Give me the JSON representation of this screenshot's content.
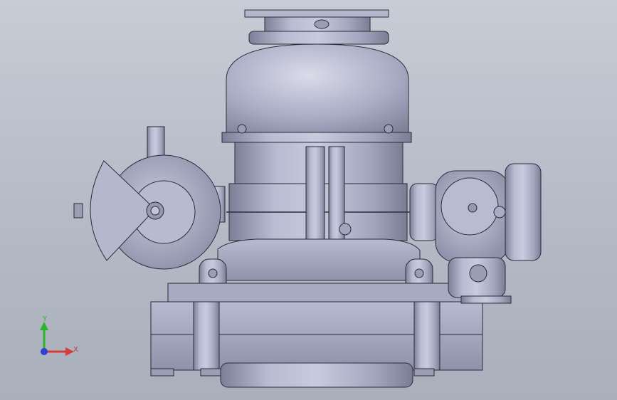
{
  "viewport": {
    "background_top": "#c7ccd6",
    "background_bottom": "#a9afbb",
    "model_color": "#a9acc4"
  },
  "triad": {
    "y_label": "Y",
    "x_label": "X",
    "y_color": "#2bb52b",
    "x_color": "#d43c3c",
    "z_color": "#2f3fd0"
  }
}
